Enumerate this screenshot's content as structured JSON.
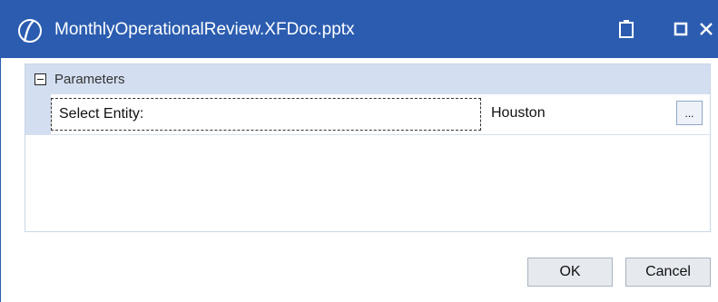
{
  "window": {
    "title": "MonthlyOperationalReview.XFDoc.pptx",
    "accent_color": "#2b5cb0",
    "icons": [
      "app-logo-icon",
      "clipboard-icon",
      "maximize-icon",
      "close-icon"
    ]
  },
  "parameters": {
    "section_title": "Parameters",
    "rows": [
      {
        "label": "Select Entity:",
        "value": "Houston",
        "button_label": "..."
      }
    ]
  },
  "footer": {
    "ok_label": "OK",
    "cancel_label": "Cancel"
  }
}
